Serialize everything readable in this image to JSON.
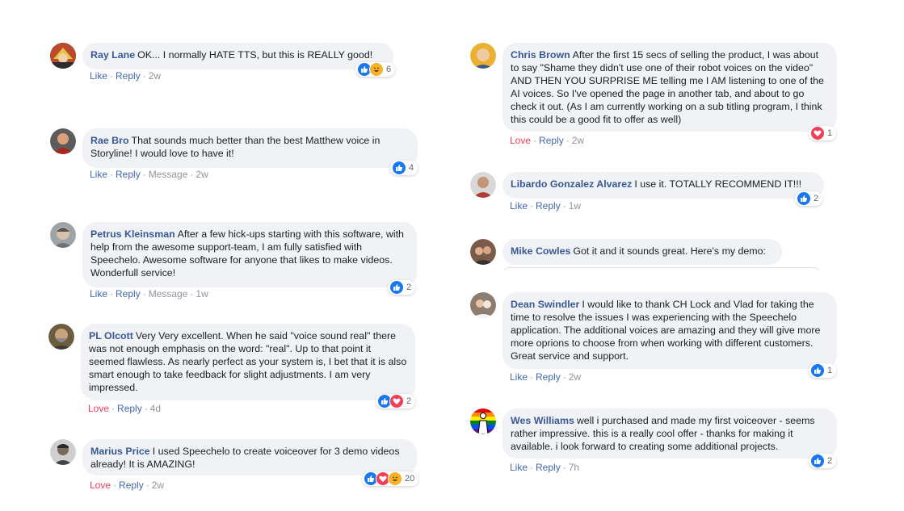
{
  "labels": {
    "like": "Like",
    "reply": "Reply",
    "message": "Message",
    "love": "Love",
    "dot": "·"
  },
  "colors": {
    "author": "#385898",
    "bubble": "#f0f2f5",
    "like_blue": "#4267b2",
    "love_red": "#f33e58",
    "muted": "#90949c"
  },
  "comments": [
    {
      "author": "Ray Lane",
      "text": "OK... I normally HATE TTS, but this is REALLY good!",
      "actions": [
        "Like",
        "Reply"
      ],
      "time": "2w",
      "reactions": [
        "like-icon",
        "haha-icon"
      ],
      "reaction_count": "6"
    },
    {
      "author": "Rae Bro",
      "text": "That sounds much better than the best Matthew voice in Storyline! I would love to have it!",
      "actions": [
        "Like",
        "Reply",
        "Message"
      ],
      "time": "2w",
      "reactions": [
        "like-icon"
      ],
      "reaction_count": "4"
    },
    {
      "author": "Petrus Kleinsman",
      "text": "After a few hick-ups starting with this software, with help from the awesome support-team, I am fully satisfied with Speechelo. Awesome software for anyone that likes to make videos. Wonderfull service!",
      "actions": [
        "Like",
        "Reply",
        "Message"
      ],
      "time": "1w",
      "reactions": [
        "like-icon"
      ],
      "reaction_count": "2"
    },
    {
      "author": "PL Olcott",
      "text": "Very Very excellent. When he said \"voice sound real\" there was not enough emphasis on the word: \"real\". Up to that point it seemed flawless. As nearly perfect as your system is, I bet that it is also smart enough to take feedback for slight adjustments. I am very impressed.",
      "actions": [
        "Love",
        "Reply"
      ],
      "time": "4d",
      "reactions": [
        "like-icon",
        "love-icon"
      ],
      "reaction_count": "2"
    },
    {
      "author": "Marius Price",
      "text": "I used Speechelo to create voiceover for 3 demo videos already! It is AMAZING!",
      "actions": [
        "Love",
        "Reply"
      ],
      "time": "2w",
      "reactions": [
        "like-icon",
        "love-icon",
        "haha-icon"
      ],
      "reaction_count": "20"
    },
    {
      "author": "Chris Brown",
      "text": "After the first 15 secs of selling the product, I was about to say \"Shame they didn't use one of their robot voices on the video\" AND THEN YOU SURPRISE ME telling me I AM listening to one of the AI voices. So I've opened the page in another tab, and about to go check it out. (As I am currently working on a sub titling program, I think this could be a good fit to offer as well)",
      "actions": [
        "Love",
        "Reply"
      ],
      "time": "2w",
      "reactions": [
        "love-icon"
      ],
      "reaction_count": "1"
    },
    {
      "author": "Libardo Gonzalez Alvarez",
      "text": "I use it. TOTALLY RECOMMEND IT!!!",
      "actions": [
        "Like",
        "Reply"
      ],
      "time": "1w",
      "reactions": [
        "like-icon"
      ],
      "reaction_count": "2"
    },
    {
      "author": "Mike Cowles",
      "text": "Got it and it sounds great. Here's my demo:"
    },
    {
      "author": "Dean Swindler",
      "text": "I would like to thank CH Lock and Vlad for taking the time to resolve the issues I was experiencing with the Speechelo application. The additional voices are amazing and they will give more more oprions to choose from when working with different customers. Great service and support.",
      "actions": [
        "Like",
        "Reply"
      ],
      "time": "2w",
      "reactions": [
        "like-icon"
      ],
      "reaction_count": "1"
    },
    {
      "author": "Wes Williams",
      "text": "well i purchased and made my first voiceover - seems rather impressive. this is a really cool offer - thanks for making it available. i look forward to creating some additional projects.",
      "actions": [
        "Like",
        "Reply"
      ],
      "time": "7h",
      "reactions": [
        "like-icon"
      ],
      "reaction_count": "2"
    }
  ]
}
